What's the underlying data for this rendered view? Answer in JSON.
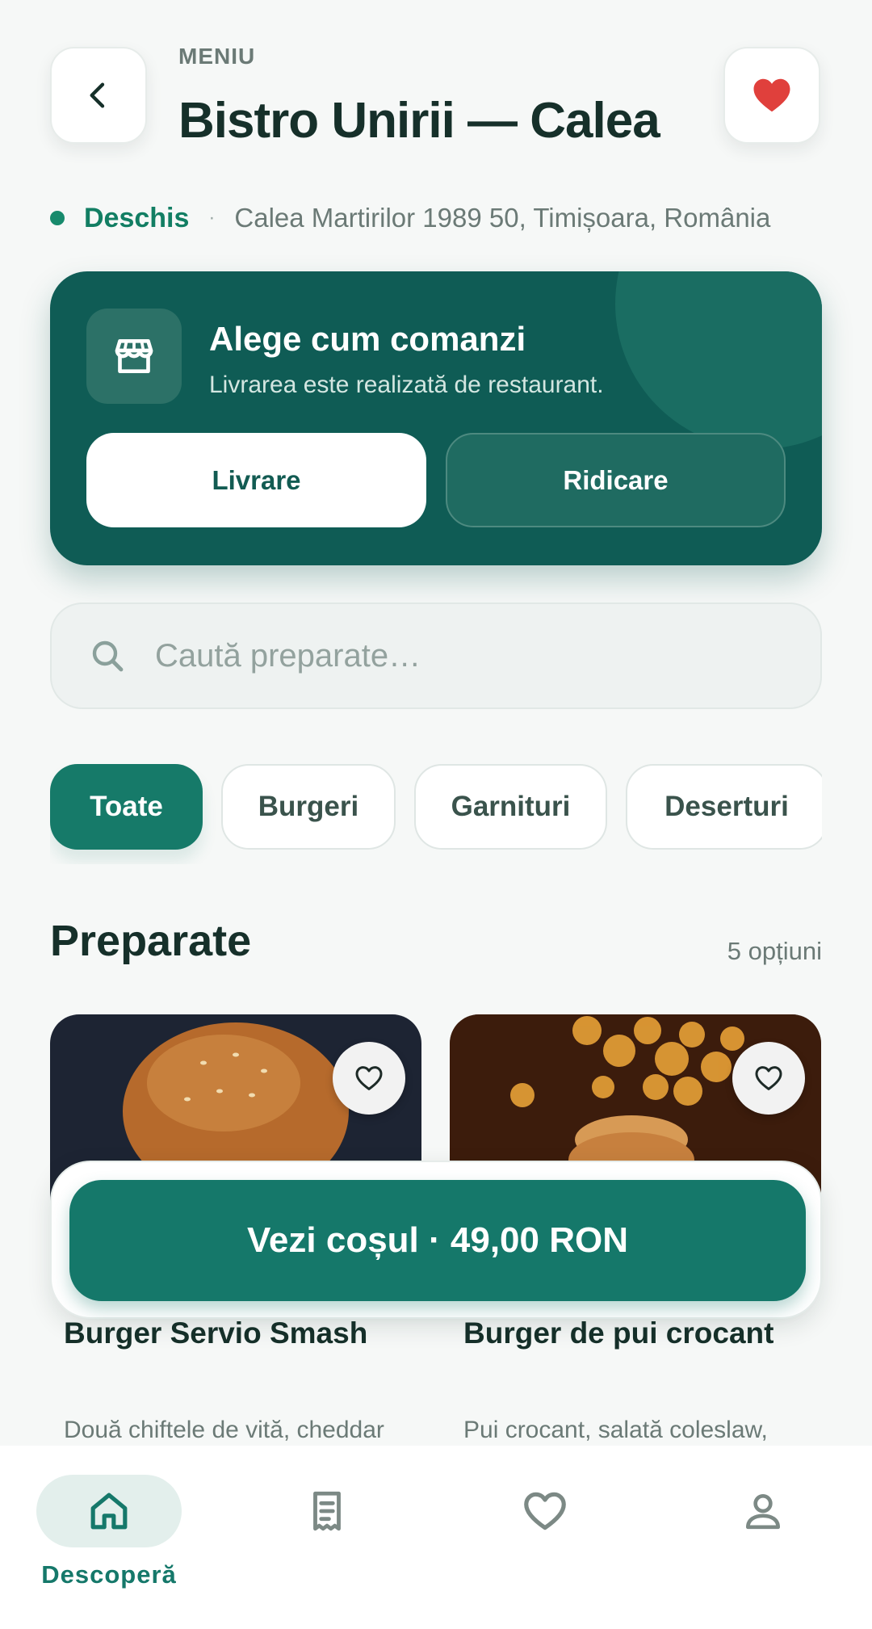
{
  "header": {
    "overline": "MENIU",
    "title": "Bistro Unirii — Calea",
    "back_icon": "chevron-left-icon",
    "favorite_icon": "heart-filled-icon"
  },
  "status": {
    "label": "Deschis",
    "separator": "·",
    "address": "Calea Martirilor 1989 50, Timișoara, România"
  },
  "order_mode": {
    "title": "Alege cum comanzi",
    "subtitle": "Livrarea este realizată de restaurant.",
    "icon": "store-icon",
    "options": [
      {
        "label": "Livrare",
        "selected": true
      },
      {
        "label": "Ridicare",
        "selected": false
      }
    ]
  },
  "search": {
    "placeholder": "Caută preparate…",
    "value": ""
  },
  "categories": [
    {
      "label": "Toate",
      "selected": true
    },
    {
      "label": "Burgeri",
      "selected": false
    },
    {
      "label": "Garnituri",
      "selected": false
    },
    {
      "label": "Deserturi",
      "selected": false
    }
  ],
  "section": {
    "title": "Preparate",
    "count": "5 opțiuni"
  },
  "items": [
    {
      "name": "Burger Servio Smash",
      "description": "Două chiftele de vită, cheddar",
      "favorite": false
    },
    {
      "name": "Burger de pui crocant",
      "description": "Pui crocant, salată coleslaw,",
      "favorite": false
    }
  ],
  "cart": {
    "label": "Vezi coșul · 49,00 RON"
  },
  "bottom_nav": [
    {
      "icon": "home-icon",
      "label": "Descoperă",
      "active": true
    },
    {
      "icon": "receipt-icon",
      "label": "",
      "active": false
    },
    {
      "icon": "heart-outline-icon",
      "label": "",
      "active": false
    },
    {
      "icon": "user-icon",
      "label": "",
      "active": false
    }
  ],
  "colors": {
    "brand_dark": "#0f5c55",
    "brand": "#15786a",
    "favorite_red": "#e0403c",
    "background": "#f6f8f7"
  }
}
